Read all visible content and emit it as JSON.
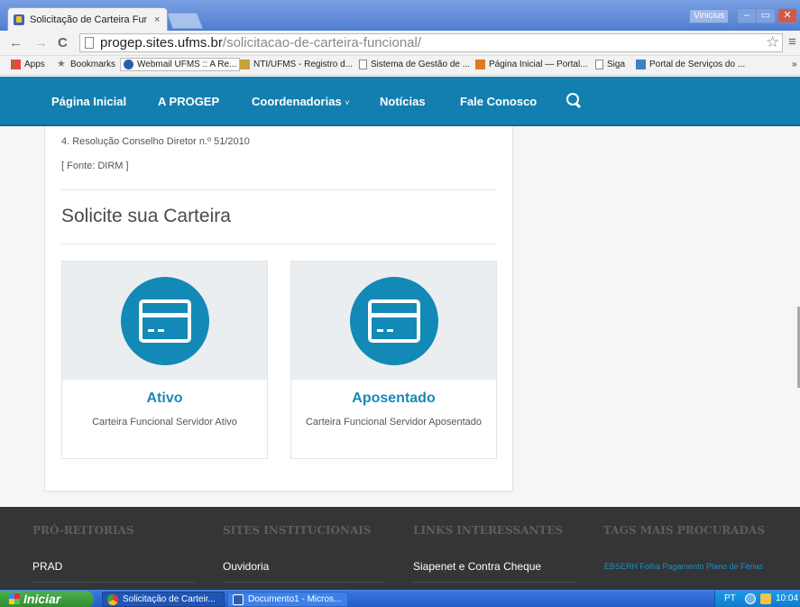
{
  "browser": {
    "tab_title": "Solicitação de Carteira Funci",
    "tab_close": "×",
    "user": "Vinicius",
    "win_min": "–",
    "win_max": "▭",
    "win_close": "✕",
    "url_host": "progep.sites.ufms.br",
    "url_path": "/solicitacao-de-carteira-funcional/",
    "bookmarks": [
      "Apps",
      "Bookmarks",
      "Webmail UFMS :: A Re...",
      "NTI/UFMS - Registro d...",
      "Sistema de Gestão de ...",
      "Página Inicial — Portal...",
      "Siga",
      "Portal de Serviços do ..."
    ],
    "more": "»"
  },
  "nav": {
    "items": [
      "Página Inicial",
      "A PROGEP",
      "Coordenadorias",
      "Notícias",
      "Fale Conosco"
    ],
    "caret": "˅"
  },
  "main": {
    "line1": "4. Resolução Conselho Diretor n.º 51/2010",
    "line2": "[ Fonte: DIRM ]",
    "heading": "Solicite sua Carteira",
    "options": [
      {
        "title": "Ativo",
        "desc": "Carteira Funcional Servidor Ativo",
        "icon": "card-icon"
      },
      {
        "title": "Aposentado",
        "desc": "Carteira Funcional Servidor Aposentado",
        "icon": "card-icon"
      }
    ]
  },
  "footer": {
    "headers": [
      "PRÓ-REITORIAS",
      "SITES INSTITUCIONAIS",
      "LINKS INTERESSANTES",
      "TAGS MAIS PROCURADAS"
    ],
    "links": [
      "PRAD",
      "Ouvidoria",
      "Siapenet e Contra Cheque"
    ],
    "tags": "EBSERH Folha Pagamento Plano de Férias"
  },
  "taskbar": {
    "start": "Iniciar",
    "items": [
      "Solicitação de Carteir...",
      "Documento1 - Micros..."
    ],
    "lang": "PT",
    "time": "10:04"
  },
  "colors": {
    "brand": "#137fae",
    "accent": "#1289b6",
    "footer": "#333537"
  }
}
